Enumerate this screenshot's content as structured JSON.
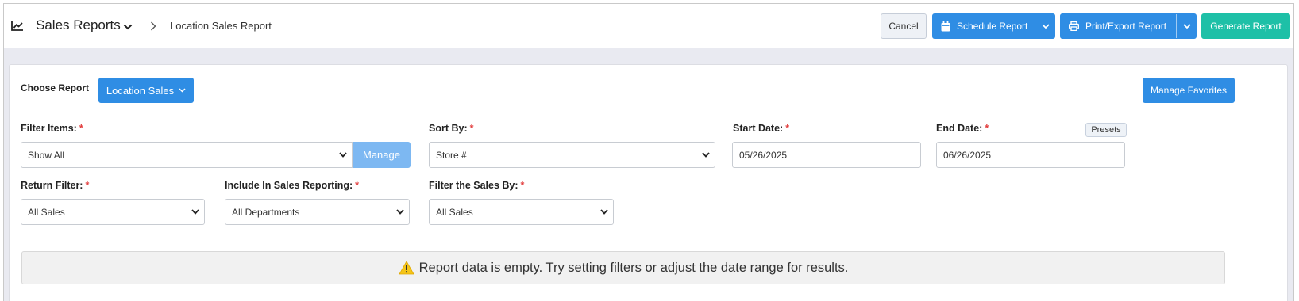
{
  "header": {
    "title": "Sales Reports",
    "current": "Location Sales Report",
    "title_icon": "chart-line-icon"
  },
  "toolbar": {
    "cancel": "Cancel",
    "schedule": "Schedule Report",
    "print": "Print/Export Report",
    "generate": "Generate Report"
  },
  "report": {
    "choose_label": "Choose Report",
    "selected": "Location Sales",
    "manage_favorites": "Manage Favorites"
  },
  "filters": {
    "filter_items": {
      "label": "Filter Items:",
      "value": "Show All",
      "manage": "Manage"
    },
    "sort_by": {
      "label": "Sort By:",
      "value": "Store #"
    },
    "start_date": {
      "label": "Start Date:",
      "value": "05/26/2025"
    },
    "end_date": {
      "label": "End Date:",
      "value": "06/26/2025",
      "presets": "Presets"
    },
    "return_filter": {
      "label": "Return Filter:",
      "value": "All Sales"
    },
    "include_in_sales": {
      "label": "Include In Sales Reporting:",
      "value": "All Departments"
    },
    "filter_sales_by": {
      "label": "Filter the Sales By:",
      "value": "All Sales"
    },
    "required_mark": "*"
  },
  "alert": {
    "message": "Report data is empty. Try setting filters or adjust the date range for results."
  },
  "colors": {
    "primary": "#2f8de4",
    "success": "#1ec0a7",
    "manage_disabled": "#7db8f2",
    "required": "#e23c3c",
    "warning": "#f5c518"
  }
}
